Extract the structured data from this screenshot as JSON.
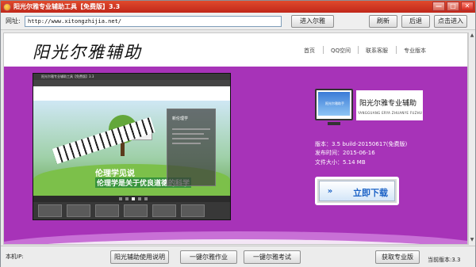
{
  "window": {
    "title": "阳光尔雅专业辅助工具【免费版】3.3",
    "controls": {
      "minimize": "—",
      "maximize": "□",
      "close": "✕"
    }
  },
  "address": {
    "label": "网址:",
    "value": "http://www.xitongzhijia.net/"
  },
  "toolbar": {
    "enter": "进入尔雅",
    "refresh": "刷新",
    "back": "后退",
    "click_enter": "点击进入"
  },
  "site": {
    "logo": "阳光尔雅辅助",
    "nav": [
      "首页",
      "QQ空间",
      "联系客服",
      "专业版本"
    ]
  },
  "preview": {
    "window_title": "阳光尔雅专业辅助工具【免费版】3.3",
    "slogan_line1": "伦理学见说",
    "slogan_line2": "伦理学是关于优良道德的科学",
    "side_title": "新伦理学"
  },
  "product": {
    "monitor_text": "阳光尔雅助手",
    "name": "阳光尔雅专业辅助",
    "subtitle": "YANGGUANG ERYA ZHUANYE FUZHU"
  },
  "details": {
    "version": "版本：3.5 build-20150617(免费版)",
    "release": "发布时间：2015-06-16",
    "size": "文件大小：5.14 MB"
  },
  "download": {
    "label": "立即下载",
    "icon": "double-chevron-down-icon"
  },
  "bottom": {
    "local_ip_label": "本机IP:",
    "buttons": [
      "阳光辅助使用说明",
      "一键尔雅作业",
      "一键尔雅考试",
      "获取专业版"
    ],
    "current_version": "当前版本:3.3"
  },
  "colors": {
    "title_red": "#c0271a",
    "purple": "#a733b8",
    "download_blue": "#1b62c6"
  }
}
